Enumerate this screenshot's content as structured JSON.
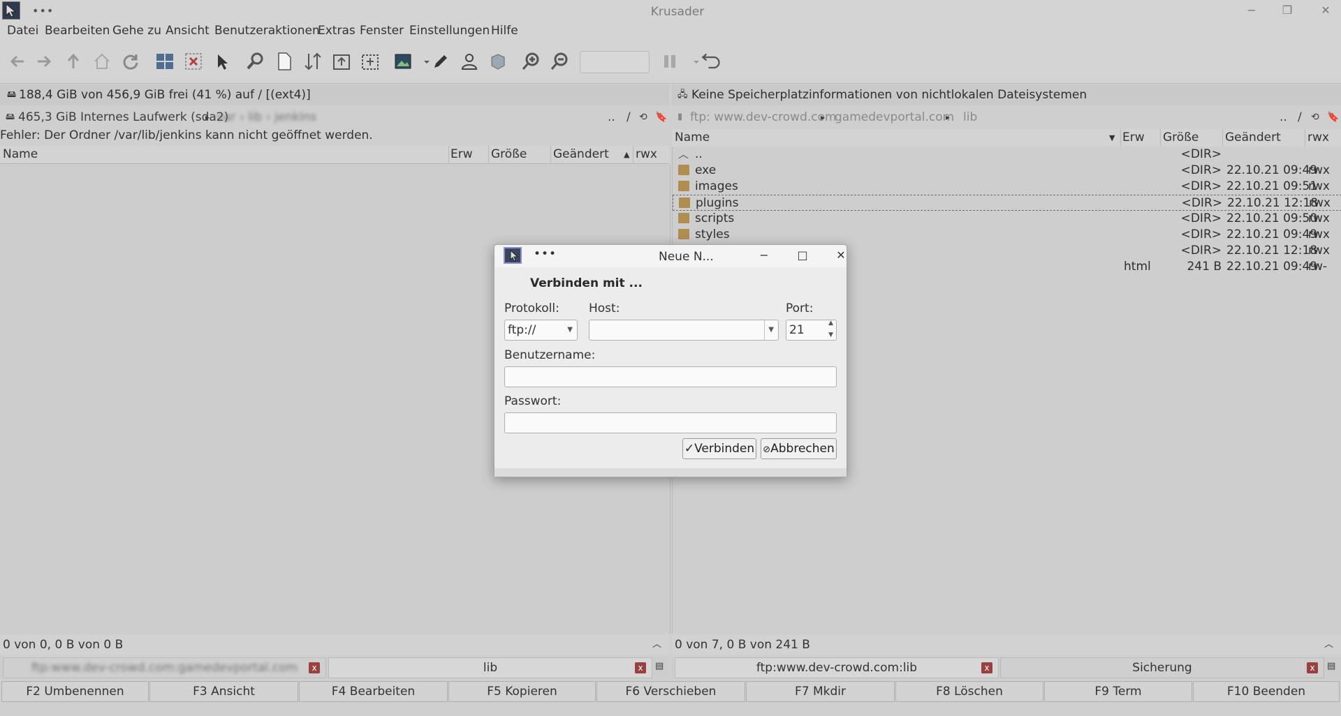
{
  "window": {
    "title": "Krusader",
    "menu_dots": "•••",
    "minimize": "−",
    "restore": "❐",
    "close": "✕"
  },
  "menu": {
    "items": [
      "Datei",
      "Bearbeiten",
      "Gehe zu",
      "Ansicht",
      "Benutzeraktionen",
      "Extras",
      "Fenster",
      "Einstellungen",
      "Hilfe"
    ]
  },
  "toolbar": {
    "icons": [
      "back-icon",
      "forward-icon",
      "up-icon",
      "home-icon",
      "refresh-icon",
      "compare-icon",
      "sync-icon",
      "select-icon",
      "search-icon",
      "new-file-icon",
      "swap-panels-icon",
      "copy-left-icon",
      "copy-right-icon",
      "image-icon",
      "edit-pen-icon",
      "user-icon",
      "cube-icon",
      "zoom-in-icon",
      "zoom-out-icon",
      "pause-icon",
      "undo-icon"
    ],
    "zoom_value": ""
  },
  "left_panel": {
    "free_space": "188,4 GiB von 456,9 GiB frei (41 %) auf / [(ext4)]",
    "drive": "465,3 GiB Internes Laufwerk (sda2)",
    "path_blurred": "var › lib › jenkins",
    "nav_up": "..",
    "nav_root": "/",
    "error": "Fehler: Der Ordner /var/lib/jenkins kann nicht geöffnet werden.",
    "columns": [
      "Name",
      "Erw",
      "Größe",
      "Geändert",
      "rwx"
    ],
    "status": "0 von 0, 0 B von 0 B"
  },
  "right_panel": {
    "free_space": "Keine Speicherplatzinformationen von nichtlokalen Dateisystemen",
    "breadcrumb": [
      "ftp: www.dev-crowd.com",
      "gamedevportal.com",
      "lib"
    ],
    "nav_up": "..",
    "nav_root": "/",
    "columns": [
      "Name",
      "Erw",
      "Größe",
      "Geändert",
      "rwx"
    ],
    "rows": [
      {
        "name": "..",
        "ext": "",
        "size": "<DIR>",
        "date": "",
        "rwx": ""
      },
      {
        "name": "exe",
        "ext": "",
        "size": "<DIR>",
        "date": "22.10.21 09:49",
        "rwx": "rwx"
      },
      {
        "name": "images",
        "ext": "",
        "size": "<DIR>",
        "date": "22.10.21 09:51",
        "rwx": "rwx"
      },
      {
        "name": "plugins",
        "ext": "",
        "size": "<DIR>",
        "date": "22.10.21 12:18",
        "rwx": "rwx"
      },
      {
        "name": "scripts",
        "ext": "",
        "size": "<DIR>",
        "date": "22.10.21 09:50",
        "rwx": "rwx"
      },
      {
        "name": "styles",
        "ext": "",
        "size": "<DIR>",
        "date": "22.10.21 09:49",
        "rwx": "rwx"
      },
      {
        "name": "",
        "ext": "",
        "size": "<DIR>",
        "date": "22.10.21 12:18",
        "rwx": "rwx"
      },
      {
        "name": "",
        "ext": "html",
        "size": "241 B",
        "date": "22.10.21 09:49",
        "rwx": "rw-"
      }
    ],
    "status": "0 von 7, 0 B von 241 B"
  },
  "tabs": {
    "left": [
      {
        "label": "ftp:www.dev-crowd.com:gamedevportal.com",
        "blurred": true
      },
      {
        "label": "lib",
        "blurred": false
      }
    ],
    "right": [
      {
        "label": "ftp:www.dev-crowd.com:lib",
        "blurred": false
      },
      {
        "label": "Sicherung",
        "blurred": false
      }
    ],
    "close_glyph": "x"
  },
  "fkeys": [
    "F2 Umbenennen",
    "F3 Ansicht",
    "F4 Bearbeiten",
    "F5 Kopieren",
    "F6 Verschieben",
    "F7 Mkdir",
    "F8 Löschen",
    "F9 Term",
    "F10 Beenden"
  ],
  "dialog": {
    "title": "Neue N...",
    "dots": "•••",
    "heading": "Verbinden mit ...",
    "protocol_label": "Protokoll:",
    "protocol_value": "ftp://",
    "host_label": "Host:",
    "host_value": "",
    "port_label": "Port:",
    "port_value": "21",
    "username_label": "Benutzername:",
    "username_value": "",
    "password_label": "Passwort:",
    "password_value": "",
    "connect_label": "Verbinden",
    "cancel_label": "Abbrechen",
    "minimize": "−",
    "maximize": "□",
    "close": "✕"
  },
  "colors": {
    "window_bg": "#d4d4d4",
    "panel_bg": "#cecece",
    "dialog_bg": "#efefef",
    "folder": "#b08e52",
    "tab_close": "#9a4040"
  }
}
